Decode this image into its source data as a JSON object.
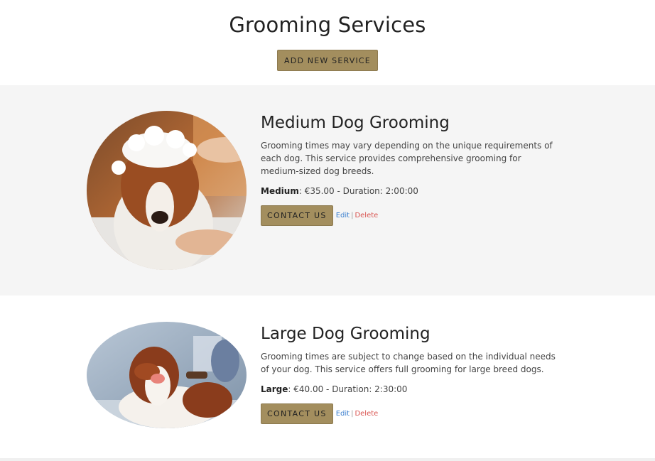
{
  "header": {
    "title": "Grooming Services",
    "add_button": "ADD NEW SERVICE"
  },
  "services": [
    {
      "title": "Medium Dog Grooming",
      "description": "Grooming times may vary depending on the unique requirements of each dog. This service provides comprehensive grooming for medium-sized dog breeds.",
      "size_label": "Medium",
      "price_text": ": €35.00 - Duration: 2:00:00",
      "contact_label": "CONTACT US",
      "edit_label": "Edit",
      "separator": "|",
      "delete_label": "Delete"
    },
    {
      "title": "Large Dog Grooming",
      "description": "Grooming times are subject to change based on the individual needs of your dog. This service offers full grooming for large breed dogs.",
      "size_label": "Large",
      "price_text": ": €40.00 - Duration: 2:30:00",
      "contact_label": "CONTACT US",
      "edit_label": "Edit",
      "separator": "|",
      "delete_label": "Delete"
    }
  ],
  "colors": {
    "accent": "#a38e5e",
    "edit_link": "#3a7fcf",
    "delete_link": "#d9534f",
    "section_grey": "#f5f5f5"
  }
}
